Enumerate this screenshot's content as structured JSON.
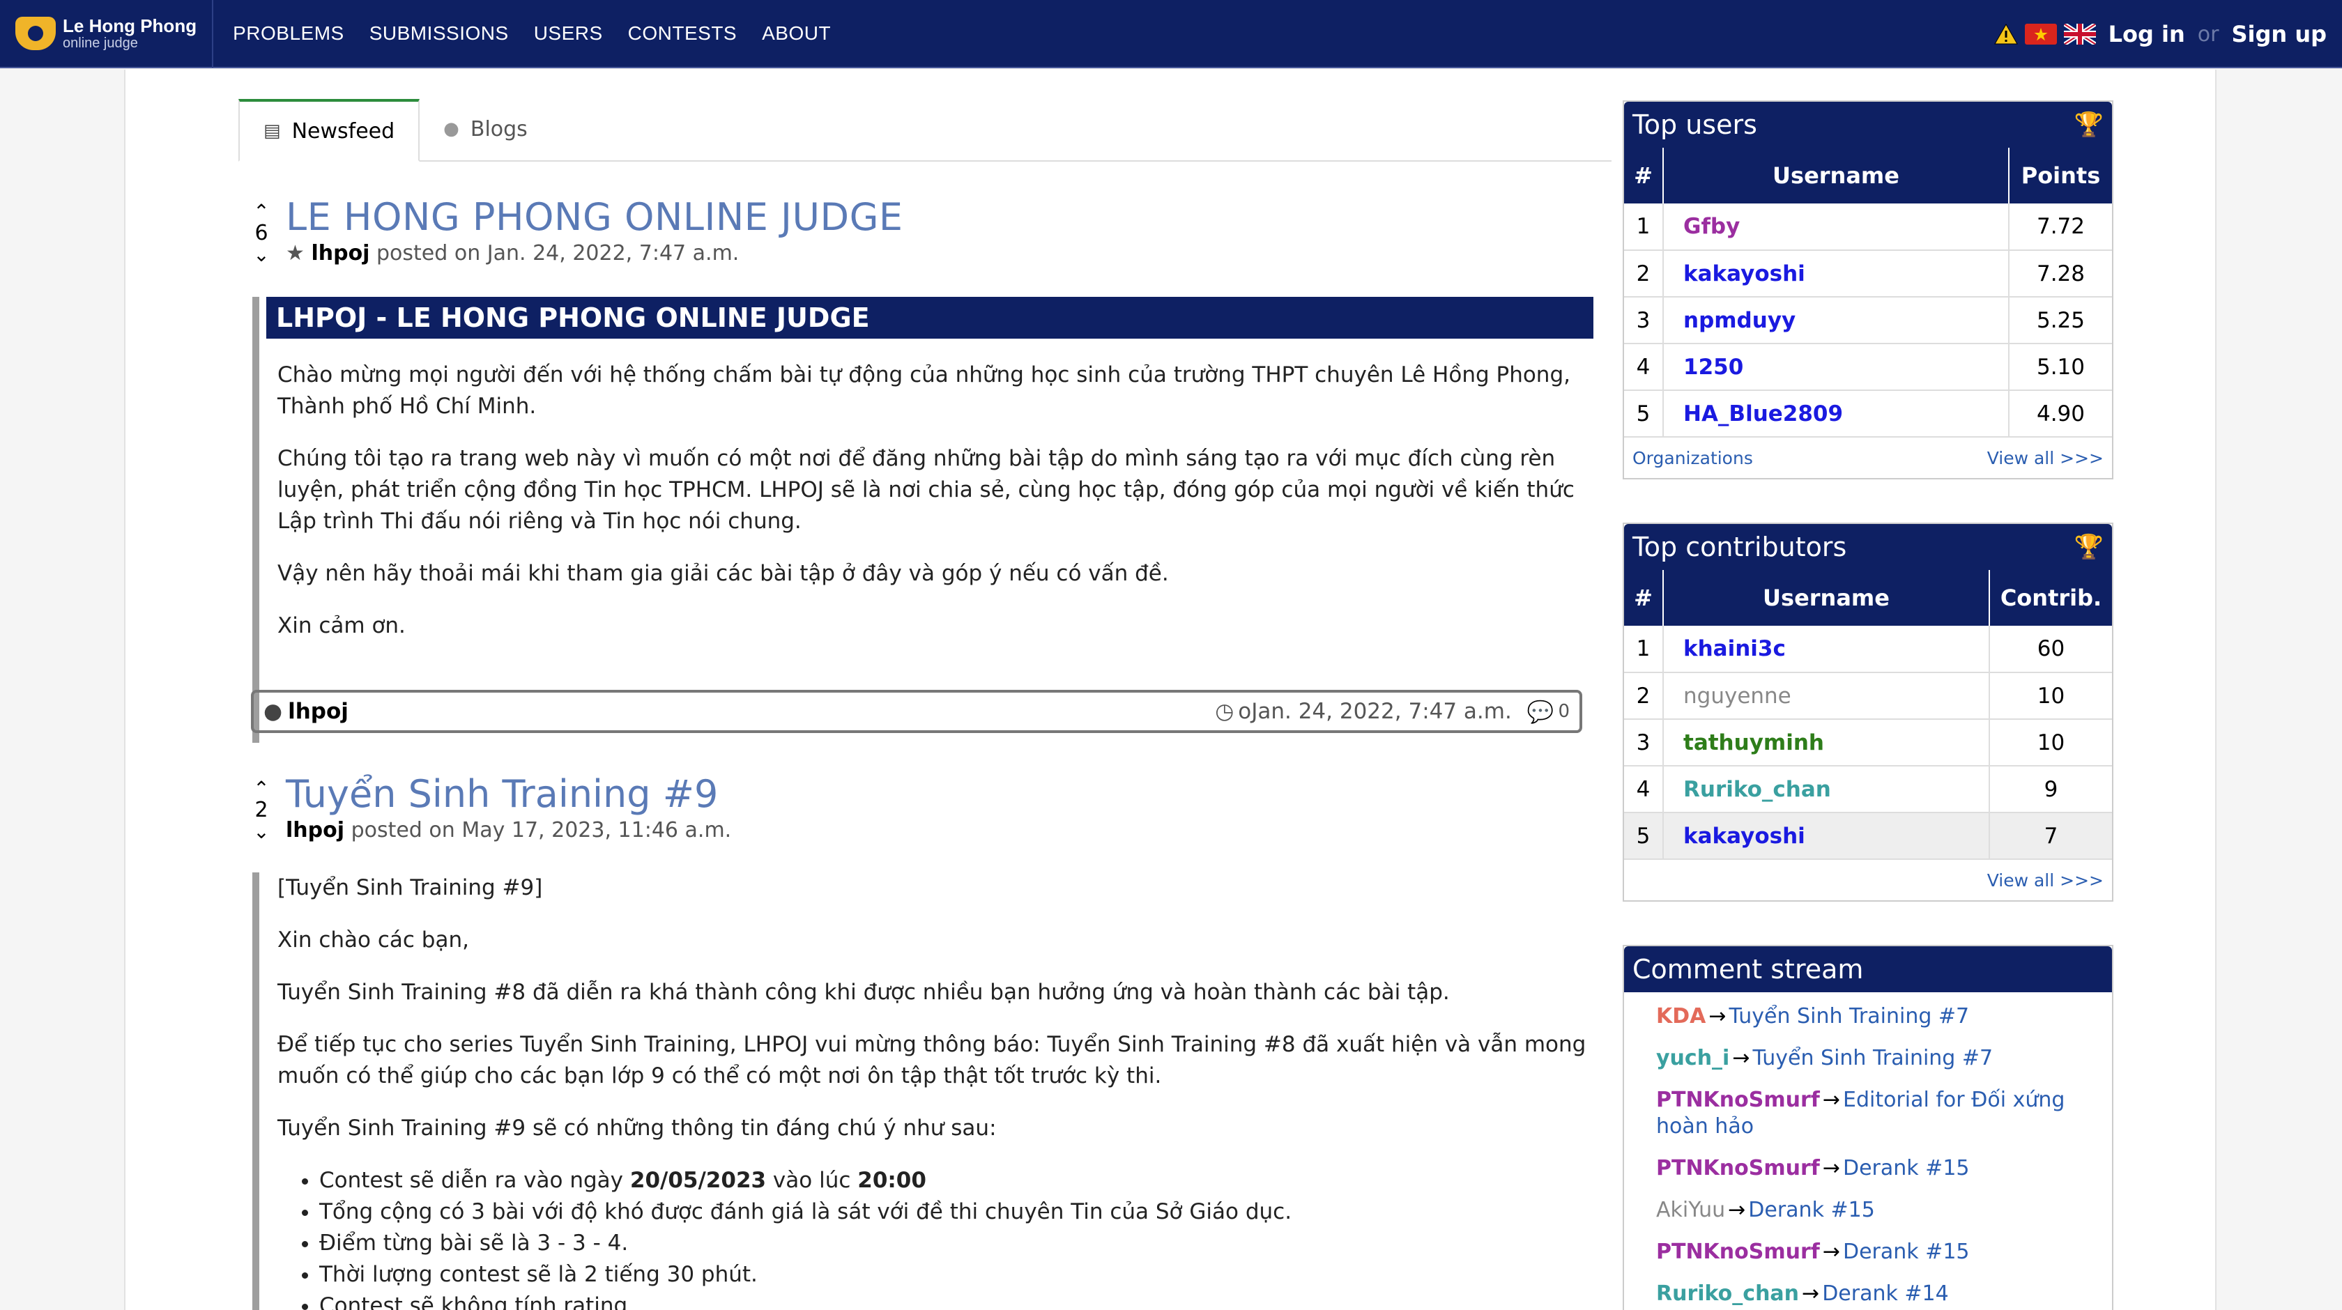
{
  "nav": {
    "logo_line1": "Le Hong Phong",
    "logo_line2": "online judge",
    "links": [
      "PROBLEMS",
      "SUBMISSIONS",
      "USERS",
      "CONTESTS",
      "ABOUT"
    ],
    "login": "Log in",
    "or": "or",
    "signup": "Sign up",
    "icons": [
      "warning-icon",
      "vietnam-flag-icon",
      "uk-flag-icon"
    ]
  },
  "tabs": [
    {
      "label": "Newsfeed",
      "icon": "newspaper-icon",
      "active": true
    },
    {
      "label": "Blogs",
      "icon": "user-icon",
      "active": false
    }
  ],
  "posts": [
    {
      "votes": "6",
      "title": "LE HONG PHONG ONLINE JUDGE",
      "author": "lhpoj",
      "posted_prefix": "posted on",
      "date": "Jan. 24, 2022, 7:47 a.m.",
      "heading": "LHPOJ - LE HONG PHONG ONLINE JUDGE",
      "paragraphs": [
        "Chào mừng mọi người đến với hệ thống chấm bài tự động của những học sinh của trường THPT chuyên Lê Hồng Phong, Thành phố Hồ Chí Minh.",
        "Chúng tôi tạo ra trang web này vì muốn có một nơi để đăng những bài tập do mình sáng tạo ra với mục đích cùng rèn luyện, phát triển cộng đồng Tin học TPHCM. LHPOJ sẽ là nơi chia sẻ, cùng học tập, đóng góp của mọi người về kiến thức Lập trình Thi đấu nói riêng và Tin học nói chung.",
        "Vậy nên hãy thoải mái khi tham gia giải các bài tập ở đây và góp ý nếu có vấn đề.",
        "Xin cảm ơn."
      ],
      "footer_author": "lhpoj",
      "footer_date": "oJan. 24, 2022, 7:47 a.m.",
      "footer_comments": "0"
    },
    {
      "votes": "2",
      "title": "Tuyển Sinh Training #9",
      "author": "lhpoj",
      "posted_prefix": "posted on",
      "date": "May 17, 2023, 11:46 a.m.",
      "paragraphs": [
        "[Tuyển Sinh Training #9]",
        "Xin chào các bạn,",
        "Tuyển Sinh Training #8 đã diễn ra khá thành công khi được nhiều bạn hưởng ứng và hoàn thành các bài tập.",
        "Để tiếp tục cho series Tuyển Sinh Training, LHPOJ vui mừng thông báo: Tuyển Sinh Training #8 đã xuất hiện và vẫn mong muốn có thể giúp cho các bạn lớp 9 có thể có một nơi ôn tập thật tốt trước kỳ thi.",
        "Tuyển Sinh Training #9 sẽ có những thông tin đáng chú ý như sau:"
      ],
      "bullets": [
        {
          "pre": "Contest sẽ diễn ra vào ngày ",
          "b1": "20/05/2023",
          "mid": " vào lúc ",
          "b2": "20:00"
        },
        {
          "pre": "Tổng cộng có 3 bài với độ khó được đánh giá là sát với đề thi chuyên Tin của Sở Giáo dục."
        },
        {
          "pre": "Điểm từng bài sẽ là 3 - 3 - 4."
        },
        {
          "pre": "Thời lượng contest sẽ là 2 tiếng 30 phút."
        },
        {
          "pre": "Contest sẽ không tính rating."
        }
      ]
    }
  ],
  "top_users": {
    "title": "Top users",
    "headers": [
      "#",
      "Username",
      "Points"
    ],
    "rows": [
      {
        "rank": "1",
        "user": "Gfby",
        "value": "7.72",
        "color": "#9b2ea0"
      },
      {
        "rank": "2",
        "user": "kakayoshi",
        "value": "7.28",
        "color": "#1a1ae0"
      },
      {
        "rank": "3",
        "user": "npmduyy",
        "value": "5.25",
        "color": "#1a1ae0"
      },
      {
        "rank": "4",
        "user": "1250",
        "value": "5.10",
        "color": "#1a1ae0"
      },
      {
        "rank": "5",
        "user": "HA_Blue2809",
        "value": "4.90",
        "color": "#1a1ae0"
      }
    ],
    "foot_left": "Organizations",
    "foot_right": "View all >>>"
  },
  "top_contributors": {
    "title": "Top contributors",
    "headers": [
      "#",
      "Username",
      "Contrib."
    ],
    "rows": [
      {
        "rank": "1",
        "user": "khaini3c",
        "value": "60",
        "color": "#1a1ae0"
      },
      {
        "rank": "2",
        "user": "nguyenne",
        "value": "10",
        "color": "#888888"
      },
      {
        "rank": "3",
        "user": "tathuyminh",
        "value": "10",
        "color": "#2e7d1a"
      },
      {
        "rank": "4",
        "user": "Ruriko_chan",
        "value": "9",
        "color": "#3aa0a0"
      },
      {
        "rank": "5",
        "user": "kakayoshi",
        "value": "7",
        "color": "#1a1ae0"
      }
    ],
    "foot_right": "View all >>>"
  },
  "comment_stream": {
    "title": "Comment stream",
    "items": [
      {
        "who": "KDA",
        "color": "#e36a5a",
        "target": "Tuyển Sinh Training #7"
      },
      {
        "who": "yuch_i",
        "color": "#3aa0a0",
        "target": "Tuyển Sinh Training #7"
      },
      {
        "who": "PTNKnoSmurf",
        "color": "#9b2ea0",
        "target": "Editorial for Đối xứng hoàn hảo"
      },
      {
        "who": "PTNKnoSmurf",
        "color": "#9b2ea0",
        "target": "Derank #15"
      },
      {
        "who": "AkiYuu",
        "color": "#888888",
        "target": "Derank #15"
      },
      {
        "who": "PTNKnoSmurf",
        "color": "#9b2ea0",
        "target": "Derank #15"
      },
      {
        "who": "Ruriko_chan",
        "color": "#3aa0a0",
        "target": "Derank #14"
      }
    ]
  }
}
